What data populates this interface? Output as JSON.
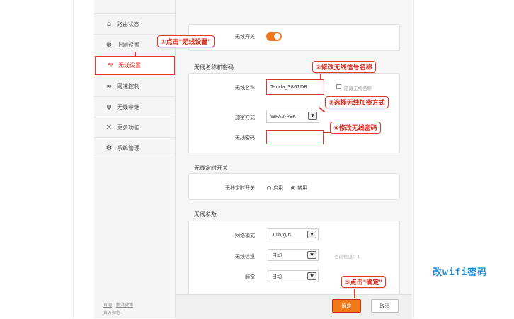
{
  "sidebar": {
    "items": [
      {
        "icon": "router-icon",
        "glyph": "⌂",
        "label": "路由状态"
      },
      {
        "icon": "globe-icon",
        "glyph": "⊕",
        "label": "上网设置"
      },
      {
        "icon": "wifi-icon",
        "glyph": "≋",
        "label": "无线设置",
        "active": true
      },
      {
        "icon": "speed-icon",
        "glyph": "≈",
        "label": "网速控制"
      },
      {
        "icon": "relay-icon",
        "glyph": "ψ",
        "label": "无线中继"
      },
      {
        "icon": "tools-icon",
        "glyph": "✕",
        "label": "更多功能"
      },
      {
        "icon": "gear-icon",
        "glyph": "⚙",
        "label": "系统管理"
      }
    ],
    "footer_links": [
      "官网",
      "新浪微博",
      "官方微信"
    ]
  },
  "wireless_switch": {
    "label": "无线开关",
    "on": true
  },
  "name_password_section": {
    "title": "无线名称和密码",
    "ssid_label": "无线名称",
    "ssid_value": "Tenda_3861D8",
    "hide_label": "隐藏无线名称",
    "encryption_label": "加密方式",
    "encryption_value": "WPA2-PSK",
    "password_label": "无线密码",
    "password_value": ""
  },
  "schedule_section": {
    "title": "无线定时开关",
    "label": "无线定时开关",
    "option_enable": "启用",
    "option_disable": "禁用",
    "selected": "禁用"
  },
  "params_section": {
    "title": "无线参数",
    "mode_label": "网络模式",
    "mode_value": "11b/g/n",
    "channel_label": "无线信道",
    "channel_value": "自动",
    "channel_hint": "当前信道：1",
    "bandwidth_label": "频宽",
    "bandwidth_value": "自动"
  },
  "buttons": {
    "ok": "确定",
    "cancel": "取消"
  },
  "callouts": {
    "step1": "①点击\"无线设置\"",
    "step2": "②修改无线信号名称",
    "step3": "③选择无线加密方式",
    "step4": "④修改无线密码",
    "step5": "⑤点击\"确定\""
  },
  "side_caption": "改wifi密码",
  "colors": {
    "accent": "#f07a1a",
    "annotation_red": "#e4382b",
    "caption_blue": "#1e88d2"
  }
}
